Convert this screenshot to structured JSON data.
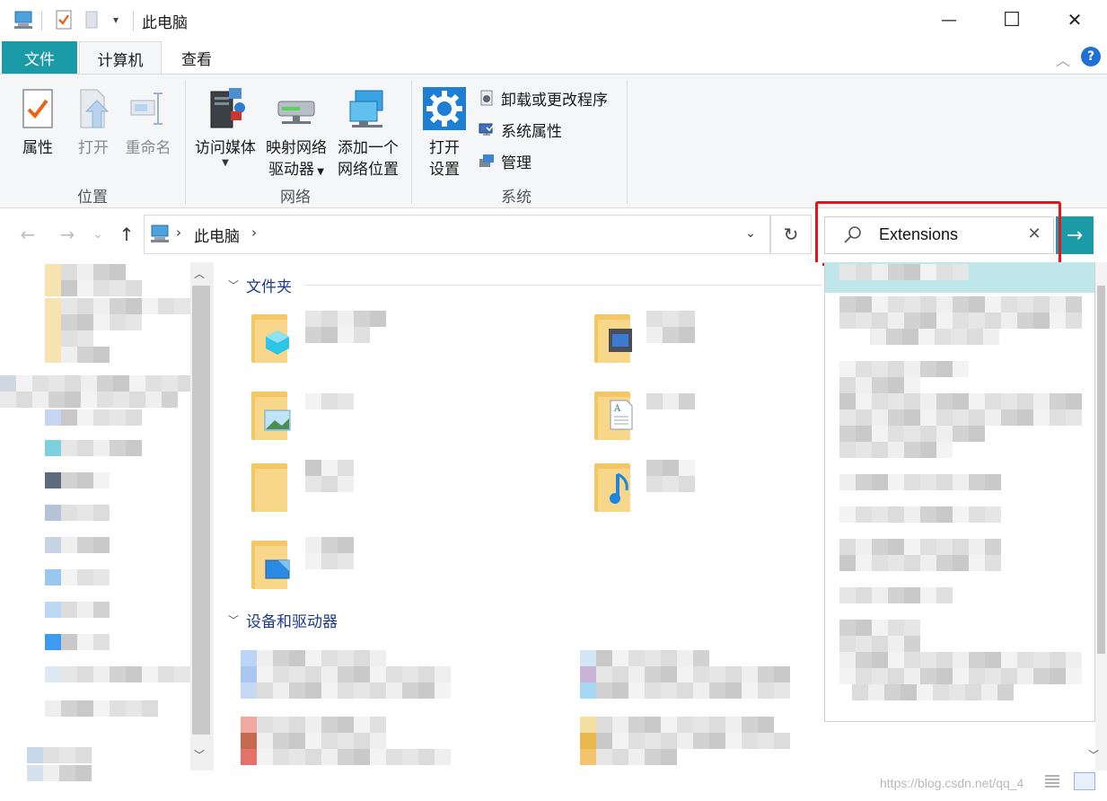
{
  "window": {
    "title": "此电脑",
    "minimize_glyph": "—",
    "maximize_glyph": "☐",
    "close_glyph": "✕"
  },
  "ribbon": {
    "tabs": [
      "文件",
      "计算机",
      "查看"
    ],
    "location_group": {
      "label": "位置",
      "buttons": [
        {
          "label": "属性",
          "icon": "properties-icon",
          "enabled": true
        },
        {
          "label": "打开",
          "icon": "open-icon",
          "enabled": false
        },
        {
          "label": "重命名",
          "icon": "rename-icon",
          "enabled": false
        }
      ]
    },
    "network_group": {
      "label": "网络",
      "buttons": [
        {
          "label_line1": "访问媒体",
          "label_line2": "",
          "icon": "media-server-icon",
          "has_dropdown": true
        },
        {
          "label_line1": "映射网络",
          "label_line2": "驱动器",
          "icon": "network-drive-icon",
          "has_dropdown": true
        },
        {
          "label_line1": "添加一个",
          "label_line2": "网络位置",
          "icon": "network-location-icon",
          "has_dropdown": false
        }
      ]
    },
    "system_group": {
      "label": "系统",
      "open_settings_line1": "打开",
      "open_settings_line2": "设置",
      "small_buttons": [
        {
          "label": "卸载或更改程序",
          "icon": "uninstall-icon"
        },
        {
          "label": "系统属性",
          "icon": "system-properties-icon"
        },
        {
          "label": "管理",
          "icon": "manage-icon"
        }
      ]
    }
  },
  "navigation": {
    "back_glyph": "←",
    "forward_glyph": "→",
    "recent_glyph": "⌄",
    "up_glyph": "↑",
    "breadcrumb": "此电脑",
    "refresh_glyph": "↻"
  },
  "search": {
    "value": "Extensions",
    "clear_glyph": "✕",
    "go_glyph": "→"
  },
  "main": {
    "section_folders": "文件夹",
    "section_devices": "设备和驱动器"
  },
  "watermark": "https://blog.csdn.net/qq_4"
}
